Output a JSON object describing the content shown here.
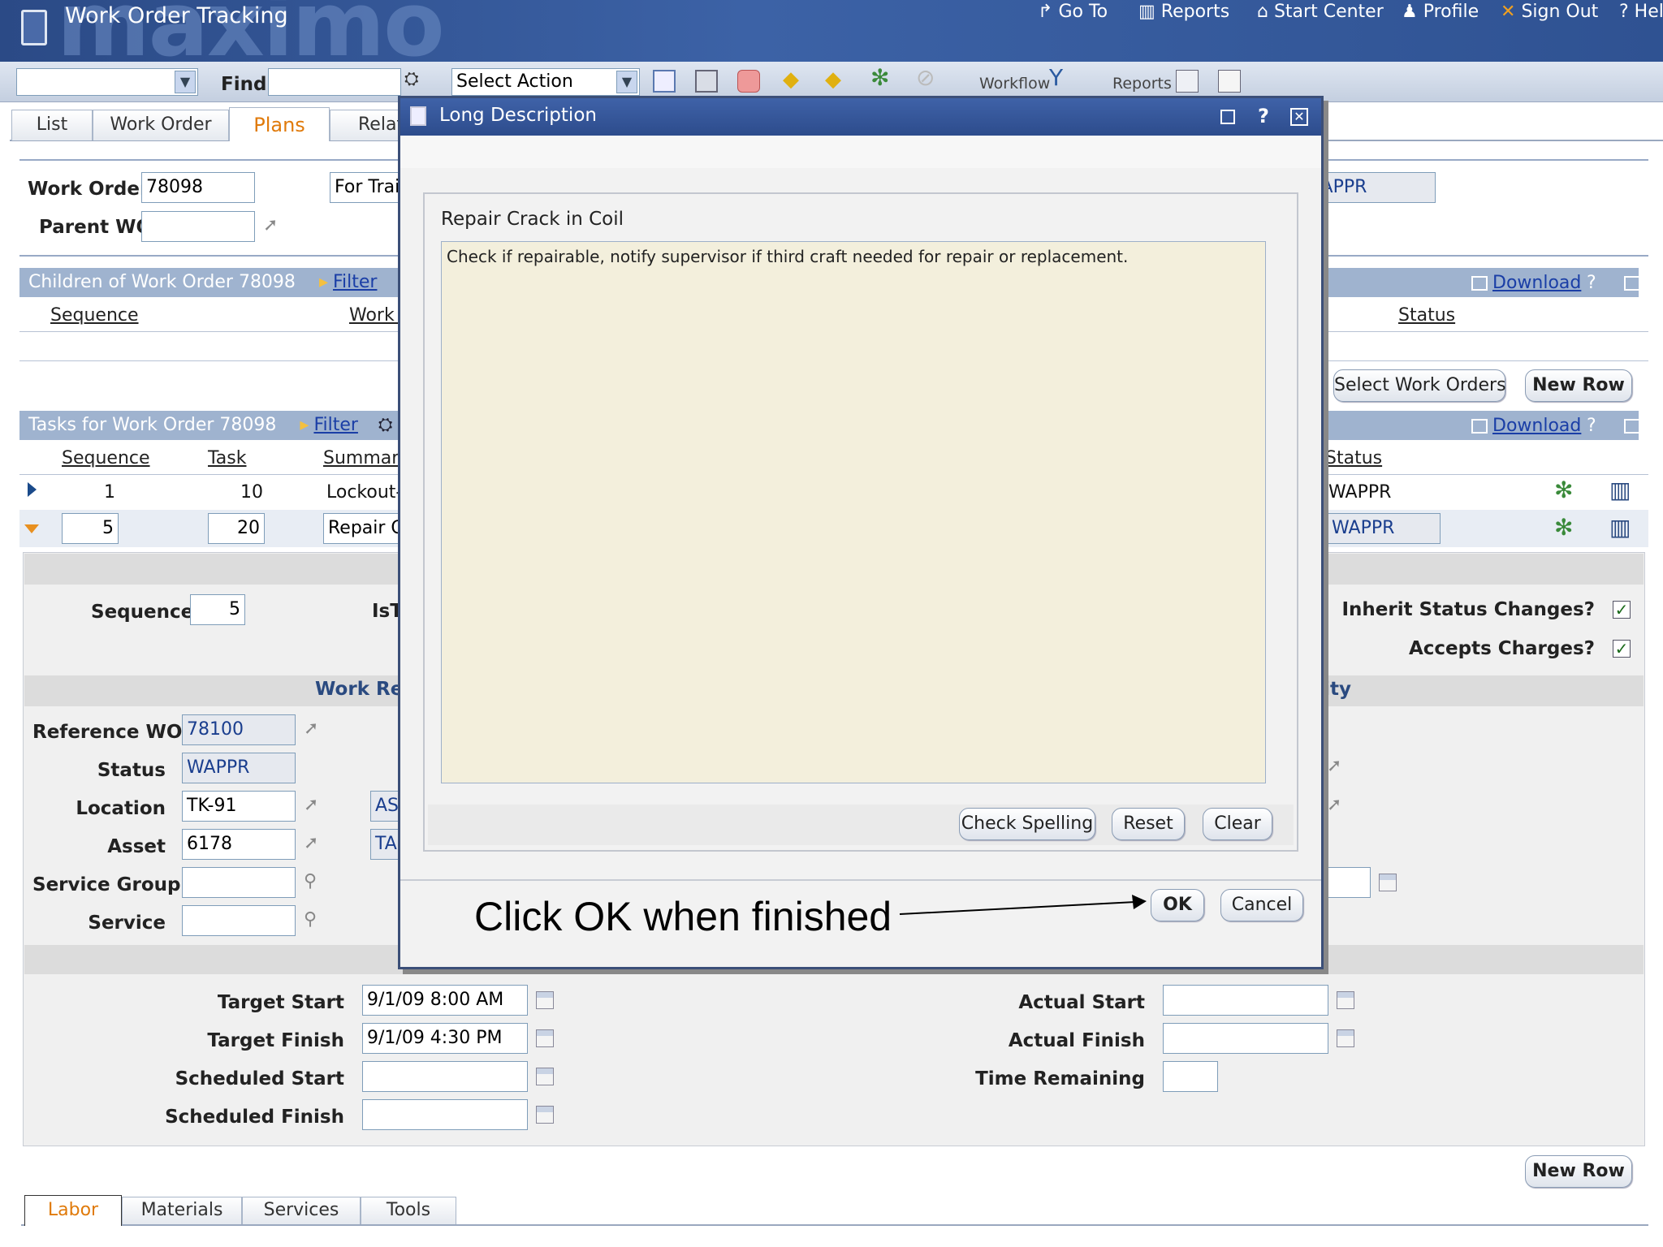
{
  "header": {
    "title": "Work Order Tracking",
    "brand": "maximo",
    "nav": [
      "Go To",
      "Reports",
      "Start Center",
      "Profile",
      "Sign Out",
      "Help"
    ]
  },
  "toolbar": {
    "find_label": "Find:",
    "find_value": "",
    "select_action": "Select Action",
    "workflow_label": "Workflow",
    "reports_label": "Reports"
  },
  "tabs": [
    "List",
    "Work Order",
    "Plans",
    "Related Records"
  ],
  "active_tab": "Plans",
  "wo": {
    "work_order_label": "Work Order",
    "work_order_value": "78098",
    "parent_label": "Parent WO",
    "parent_value": "",
    "desc_value": "For Training",
    "status_value": "WAPPR"
  },
  "children": {
    "title": "Children of Work Order 78098",
    "filter": "Filter",
    "download": "Download",
    "help": "?",
    "cols": [
      "Sequence",
      "Work Order",
      "Status"
    ],
    "select_btn": "Select Work Orders",
    "new_row": "New Row"
  },
  "tasks": {
    "title": "Tasks for Work Order 78098",
    "filter": "Filter",
    "download": "Download",
    "help": "?",
    "cols": [
      "Sequence",
      "Task",
      "Summary",
      "Status"
    ],
    "rows": [
      {
        "seq": "1",
        "task": "10",
        "summary": "Lockout-Tagout",
        "status": "WAPPR"
      },
      {
        "seq": "5",
        "task": "20",
        "summary": "Repair Crack in Coil",
        "status": "WAPPR"
      }
    ]
  },
  "detail": {
    "sequence_label": "Sequence",
    "sequence_value": "5",
    "istask_label": "IsTask?",
    "inherit_label": "Inherit Status Changes?",
    "accepts_label": "Accepts Charges?",
    "workref_header": "Work Reference",
    "right_header": "Responsibility",
    "refwo_label": "Reference WO",
    "refwo_value": "78100",
    "status_label": "Status",
    "status_value": "WAPPR",
    "location_label": "Location",
    "location_value": "TK-91",
    "location_desc": "ASSEMBLY",
    "asset_label": "Asset",
    "asset_value": "6178",
    "asset_desc": "TANK",
    "svcgroup_label": "Service Group",
    "svcgroup_value": "",
    "service_label": "Service",
    "service_value": ""
  },
  "dates": {
    "target_start_label": "Target Start",
    "target_start": "9/1/09 8:00 AM",
    "target_finish_label": "Target Finish",
    "target_finish": "9/1/09 4:30 PM",
    "sched_start_label": "Scheduled Start",
    "sched_start": "",
    "sched_finish_label": "Scheduled Finish",
    "sched_finish": "",
    "actual_start_label": "Actual Start",
    "actual_start": "",
    "actual_finish_label": "Actual Finish",
    "actual_finish": "",
    "time_remaining_label": "Time Remaining",
    "time_remaining": ""
  },
  "bottom": {
    "new_row": "New Row",
    "tabs": [
      "Labor",
      "Materials",
      "Services",
      "Tools"
    ]
  },
  "dialog": {
    "title": "Long Description",
    "help": "?",
    "heading": "Repair Crack in Coil",
    "text": "Check if repairable, notify supervisor if third craft needed for repair or replacement.",
    "check_spelling": "Check Spelling",
    "reset": "Reset",
    "clear": "Clear",
    "ok": "OK",
    "cancel": "Cancel"
  },
  "annotation": "Click OK when finished",
  "colors": {
    "header_bg": "#2d4f8c",
    "band": "#9fb3cf",
    "textarea": "#f3efdc",
    "active_tab": "#e07a0a",
    "link": "#1a3ea6"
  }
}
